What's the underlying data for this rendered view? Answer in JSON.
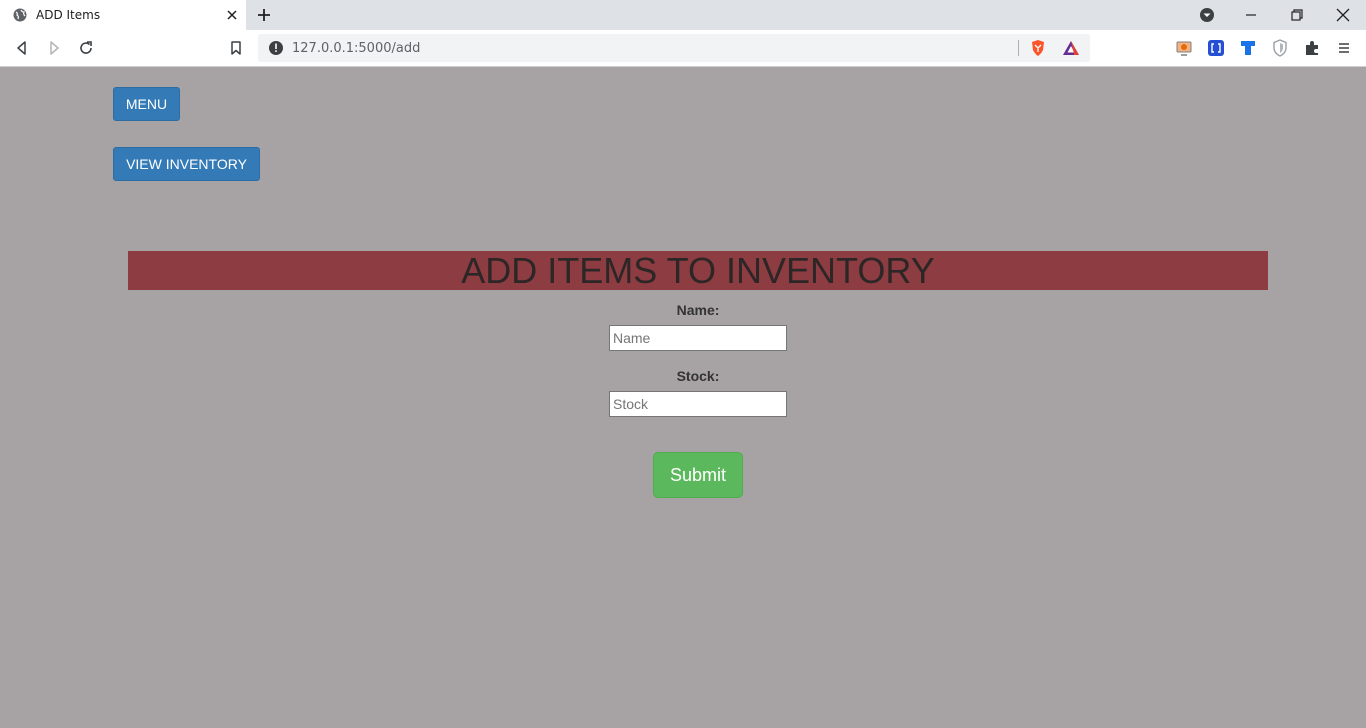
{
  "browser": {
    "tab_title": "ADD Items",
    "url": "127.0.0.1:5000/add",
    "favicon": "globe-icon",
    "toolbar_icons": [
      "back-icon",
      "forward-icon",
      "reload-icon",
      "bookmark-icon"
    ],
    "extension_icons": [
      "extension-screen-icon",
      "extension-bracket-icon",
      "extension-shield-blue-icon",
      "extension-shield-gray-icon",
      "puzzle-icon",
      "menu-icon"
    ]
  },
  "page": {
    "menu_button": "MENU",
    "view_inventory_button": "VIEW INVENTORY",
    "heading": "ADD ITEMS TO INVENTORY",
    "form": {
      "name_label": "Name:",
      "name_placeholder": "Name",
      "stock_label": "Stock:",
      "stock_placeholder": "Stock",
      "submit_label": "Submit"
    }
  },
  "colors": {
    "page_background": "#a7a3a4",
    "heading_band": "#8d3d42",
    "primary_button": "#337ab7",
    "submit_button": "#5cb85c"
  }
}
